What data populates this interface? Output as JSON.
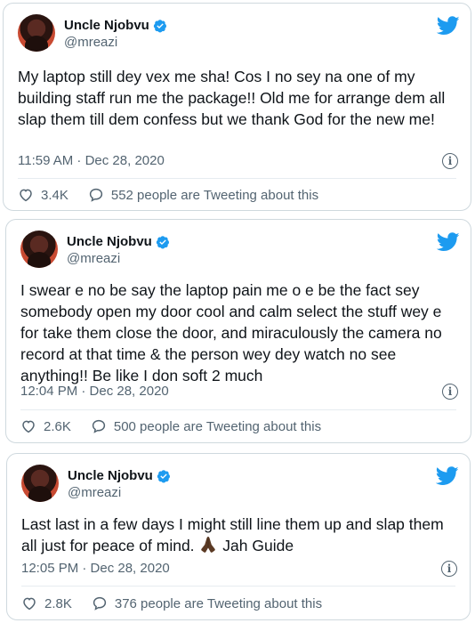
{
  "tweets": [
    {
      "name": "Uncle Njobvu",
      "handle": "@mreazi",
      "text": "My laptop still dey vex me sha! Cos I no sey na one of my building staff run me the package!! Old me for arrange dem all slap them till dem confess but we thank God for the new me!",
      "time": "11:59 AM · Dec 28, 2020",
      "likes": "3.4K",
      "tweeting": "552 people are Tweeting about this"
    },
    {
      "name": "Uncle Njobvu",
      "handle": "@mreazi",
      "text": "I swear e no be say the laptop pain me o e be the fact sey somebody open my door cool and calm select the stuff wey e for take them close the door, and miraculously the camera no record at that time & the person wey dey watch no see anything!! Be like I don soft 2 much",
      "time": "12:04 PM · Dec 28, 2020",
      "likes": "2.6K",
      "tweeting": "500 people are Tweeting about this"
    },
    {
      "name": "Uncle Njobvu",
      "handle": "@mreazi",
      "text_before": "Last last in a few days I might still line them up and slap them all just for peace of mind.",
      "text_after": "Jah Guide",
      "time": "12:05 PM · Dec 28, 2020",
      "likes": "2.8K",
      "tweeting": "376 people are Tweeting about this"
    }
  ],
  "icons": {
    "avatar": "avatar",
    "verified": "verified-badge-icon",
    "bird": "twitter-bird-icon",
    "info": "info-icon",
    "heart": "heart-icon",
    "speech": "speech-bubble-icon",
    "emoji": "folded-hands-emoji"
  },
  "colors": {
    "brand": "#1d9bf0",
    "text": "#0f1419",
    "secondary": "#536471",
    "border": "#cfd9de"
  }
}
